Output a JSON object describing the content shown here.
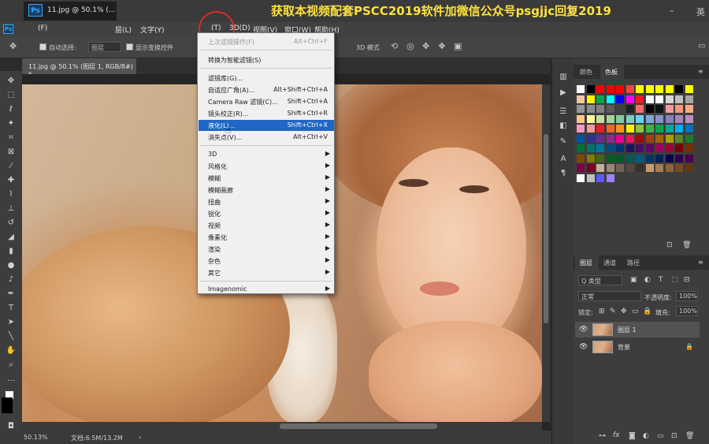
{
  "titlebar": {
    "tab_title": "11.jpg @ 50.1% (...",
    "ps_logo": "Ps",
    "banner": "获取本视频配套PSCC2019软件加微信公众号psgjjc回复2019",
    "min": "–",
    "lang": "英"
  },
  "menubar": {
    "ps_logo": "Ps",
    "items": [
      "(F)",
      "层(L)",
      "文字(Y)",
      "(T)",
      "3D(D)",
      "视图(V)",
      "窗口(W)",
      "帮助(H)"
    ]
  },
  "options": {
    "auto_select": "自动选择:",
    "layer_select": "图层",
    "show_transform": "显示变换控件",
    "mode_3d": "3D 模式"
  },
  "document": {
    "tab": "11.jpg @ 50.1% (图层 1, RGB/8#) *",
    "close": "×"
  },
  "status": {
    "zoom": "50.13%",
    "doc": "文档:6.5M/13.2M",
    "arrow": "›"
  },
  "filter_menu": {
    "items": [
      {
        "label": "上次滤镜操作(F)",
        "shortcut": "Alt+Ctrl+F",
        "state": "disabled"
      },
      {
        "label": "转换为智能滤镜(S)",
        "shortcut": "",
        "state": "normal"
      },
      {
        "label": "滤镜库(G)...",
        "shortcut": "",
        "state": "normal"
      },
      {
        "label": "自适应广角(A)...",
        "shortcut": "Alt+Shift+Ctrl+A",
        "state": "normal"
      },
      {
        "label": "Camera Raw 滤镜(C)...",
        "shortcut": "Shift+Ctrl+A",
        "state": "normal"
      },
      {
        "label": "镜头校正(R)...",
        "shortcut": "Shift+Ctrl+R",
        "state": "normal"
      },
      {
        "label": "液化(L)...",
        "shortcut": "Shift+Ctrl+X",
        "state": "highlighted"
      },
      {
        "label": "消失点(V)...",
        "shortcut": "Alt+Ctrl+V",
        "state": "normal"
      },
      {
        "label": "3D",
        "submenu": true
      },
      {
        "label": "风格化",
        "submenu": true
      },
      {
        "label": "模糊",
        "submenu": true
      },
      {
        "label": "模糊画廊",
        "submenu": true
      },
      {
        "label": "扭曲",
        "submenu": true
      },
      {
        "label": "锐化",
        "submenu": true
      },
      {
        "label": "视频",
        "submenu": true
      },
      {
        "label": "像素化",
        "submenu": true
      },
      {
        "label": "渲染",
        "submenu": true
      },
      {
        "label": "杂色",
        "submenu": true
      },
      {
        "label": "其它",
        "submenu": true
      },
      {
        "label": "Imagenomic",
        "submenu": true
      }
    ],
    "arrow_glyph": "▶"
  },
  "swatches_panel": {
    "tabs": [
      "颜色",
      "色板"
    ]
  },
  "layers_panel": {
    "tabs": [
      "图层",
      "通道",
      "路径"
    ],
    "kind": "Q 类型",
    "blend": "正常",
    "opacity_label": "不透明度:",
    "opacity": "100%",
    "lock_label": "锁定:",
    "fill_label": "填充:",
    "fill": "100%",
    "layers": [
      {
        "name": "图层 1",
        "selected": true
      },
      {
        "name": "背景",
        "selected": false,
        "locked": true
      }
    ],
    "footer_icons": [
      "link-icon",
      "fx-icon",
      "mask-icon",
      "adjustment-icon",
      "group-icon",
      "new-layer-icon",
      "trash-icon"
    ],
    "fx": "fx"
  },
  "colors": {
    "swatches": [
      "#ffffff",
      "#000000",
      "#ff0000",
      "#ff0000",
      "#ff0000",
      "#ff4040",
      "#ffff00",
      "#ffff00",
      "#ffff00",
      "#ffff00",
      "#000000",
      "#ffff00",
      "#f3c6a5",
      "#fff200",
      "#00a651",
      "#00ffff",
      "#0000ff",
      "#ff00ff",
      "#ed1c24",
      "#ffffff",
      "#ffffff",
      "#d6d6d6",
      "#c0c0c0",
      "#a6a6a6",
      "#969696",
      "#8c8c8c",
      "#808080",
      "#5a5a5a",
      "#404040",
      "#202020",
      "#ff6b6b",
      "#000000",
      "#111111",
      "#f6989d",
      "#f7977a",
      "#fbad82",
      "#fdc68c",
      "#fff79a",
      "#c4df9b",
      "#a3d39c",
      "#82ca9c",
      "#7accc8",
      "#6dcff6",
      "#7da7d9",
      "#8493ca",
      "#8882be",
      "#a187be",
      "#bc8dbf",
      "#f49ac2",
      "#f6989d",
      "#ed1c24",
      "#f26522",
      "#f7941d",
      "#fff200",
      "#8dc63f",
      "#39b54a",
      "#00a651",
      "#00a99d",
      "#00aeef",
      "#0072bc",
      "#0054a6",
      "#2e3192",
      "#662d91",
      "#92278f",
      "#ec008c",
      "#ed145b",
      "#9e0b0f",
      "#a0410d",
      "#a36209",
      "#aba000",
      "#598527",
      "#1a7b30",
      "#007236",
      "#00746b",
      "#0076a3",
      "#004b80",
      "#003471",
      "#1b1464",
      "#440e62",
      "#630460",
      "#9e005d",
      "#9e0039",
      "#790000",
      "#7b2e00",
      "#7d4900",
      "#827b00",
      "#406618",
      "#005e20",
      "#005826",
      "#005952",
      "#005b7f",
      "#003663",
      "#002157",
      "#0d004c",
      "#32004b",
      "#4b0049",
      "#7b0046",
      "#7a0026",
      "#c7b299",
      "#998675",
      "#736357",
      "#534741",
      "#37302d",
      "#c69c6d",
      "#a67c52",
      "#8c6239",
      "#754c24",
      "#603913",
      "#ffffff",
      "#c0c0c0",
      "#5a5aff",
      "#a080ff"
    ]
  }
}
